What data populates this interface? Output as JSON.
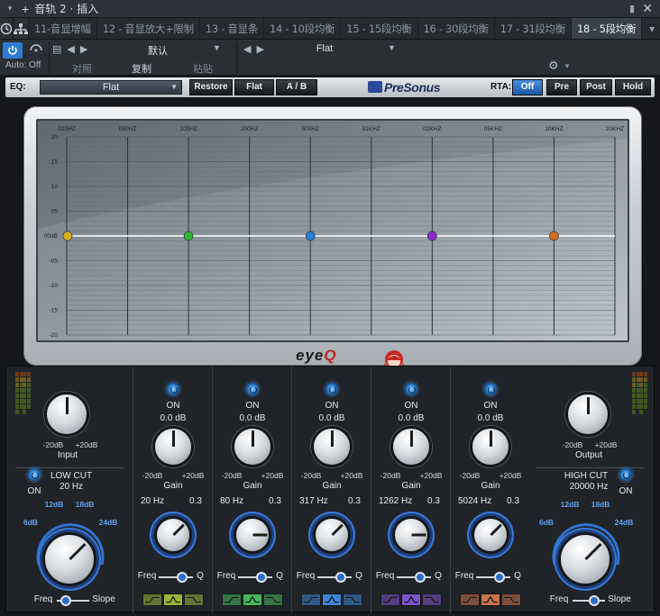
{
  "window": {
    "title": "音轨 2 · 插入",
    "pin_icon": "pin-icon",
    "close_icon": "close-icon"
  },
  "tabs": [
    {
      "label": "11-音显增幅",
      "active": false
    },
    {
      "label": "12 - 音显放大+限制",
      "active": false
    },
    {
      "label": "13 - 音显条",
      "active": false
    },
    {
      "label": "14 - 10段均衡",
      "active": false
    },
    {
      "label": "15 - 15段均衡",
      "active": false
    },
    {
      "label": "16 - 30段均衡",
      "active": false
    },
    {
      "label": "17 - 31段均衡",
      "active": false
    },
    {
      "label": "18 - 5段均衡",
      "active": true
    }
  ],
  "tabs_more": "▾",
  "controls": {
    "auto": "Auto: Off",
    "preset": "默认",
    "compare": "对照",
    "copy": "复制",
    "paste": "粘贴",
    "eq_preset": "Flat"
  },
  "plugin": {
    "eq_label": "EQ:",
    "eq_select": "Flat",
    "buttons": {
      "restore": "Restore",
      "flat": "Flat",
      "ab": "A / B"
    },
    "brand": "PreSonus",
    "rta_label": "RTA:",
    "rta_buttons": [
      {
        "label": "Off",
        "on": true
      },
      {
        "label": "Pre",
        "on": false
      },
      {
        "label": "Post",
        "on": false
      },
      {
        "label": "Hold",
        "on": false
      }
    ],
    "logo": {
      "pre": "eye",
      "q": "Q"
    }
  },
  "graph": {
    "freq_labels": [
      "020HZ",
      "050HZ",
      "100HZ",
      "200HZ",
      "500HZ",
      "01KHZ",
      "02KHZ",
      "05KHZ",
      "10KHZ",
      "20KHZ"
    ],
    "db_labels": [
      "20",
      "15",
      "10",
      "05",
      "00dB",
      "-05",
      "-10",
      "-15",
      "-20"
    ],
    "nodes": [
      {
        "color": "#d4b31c",
        "freq_index": 0
      },
      {
        "color": "#2fb53c",
        "freq_index": 1
      },
      {
        "color": "#2a7fd6",
        "freq_index": 2
      },
      {
        "color": "#8a2ad0",
        "freq_index": 3
      },
      {
        "color": "#d36a1e",
        "freq_index": 4
      }
    ]
  },
  "input": {
    "on_label": "ON",
    "range_min": "-20dB",
    "range_max": "+20dB",
    "label": "Input"
  },
  "low_cut": {
    "on_label": "ON",
    "title": "LOW CUT",
    "value": "20 Hz",
    "scale": [
      "6dB",
      "12dB",
      "18dB",
      "24dB"
    ],
    "freq": "Freq",
    "slope": "Slope"
  },
  "bands": [
    {
      "on": "ON",
      "gain": "0.0 dB",
      "min": "-20dB",
      "max": "+20dB",
      "gain_label": "Gain",
      "freq": "20 Hz",
      "q": "0.3",
      "freq_label": "Freq",
      "q_label": "Q",
      "color": "#9bb53a"
    },
    {
      "on": "ON",
      "gain": "0.0 dB",
      "min": "-20dB",
      "max": "+20dB",
      "gain_label": "Gain",
      "freq": "80 Hz",
      "q": "0.3",
      "freq_label": "Freq",
      "q_label": "Q",
      "color": "#45b75a"
    },
    {
      "on": "ON",
      "gain": "0.0 dB",
      "min": "-20dB",
      "max": "+20dB",
      "gain_label": "Gain",
      "freq": "317 Hz",
      "q": "0.3",
      "freq_label": "Freq",
      "q_label": "Q",
      "color": "#3b86d8"
    },
    {
      "on": "ON",
      "gain": "0.0 dB",
      "min": "-20dB",
      "max": "+20dB",
      "gain_label": "Gain",
      "freq": "1262 Hz",
      "q": "0.3",
      "freq_label": "Freq",
      "q_label": "Q",
      "color": "#7a54c9"
    },
    {
      "on": "ON",
      "gain": "0.0 dB",
      "min": "-20dB",
      "max": "+20dB",
      "gain_label": "Gain",
      "freq": "5024 Hz",
      "q": "0.3",
      "freq_label": "Freq",
      "q_label": "Q",
      "color": "#c6744a"
    }
  ],
  "output": {
    "on_label": "ON",
    "range_min": "-20dB",
    "range_max": "+20dB",
    "label": "Output"
  },
  "high_cut": {
    "on_label": "ON",
    "title": "HIGH CUT",
    "value": "20000 Hz",
    "scale": [
      "6dB",
      "12dB",
      "18dB",
      "24dB"
    ],
    "freq": "Freq",
    "slope": "Slope"
  }
}
